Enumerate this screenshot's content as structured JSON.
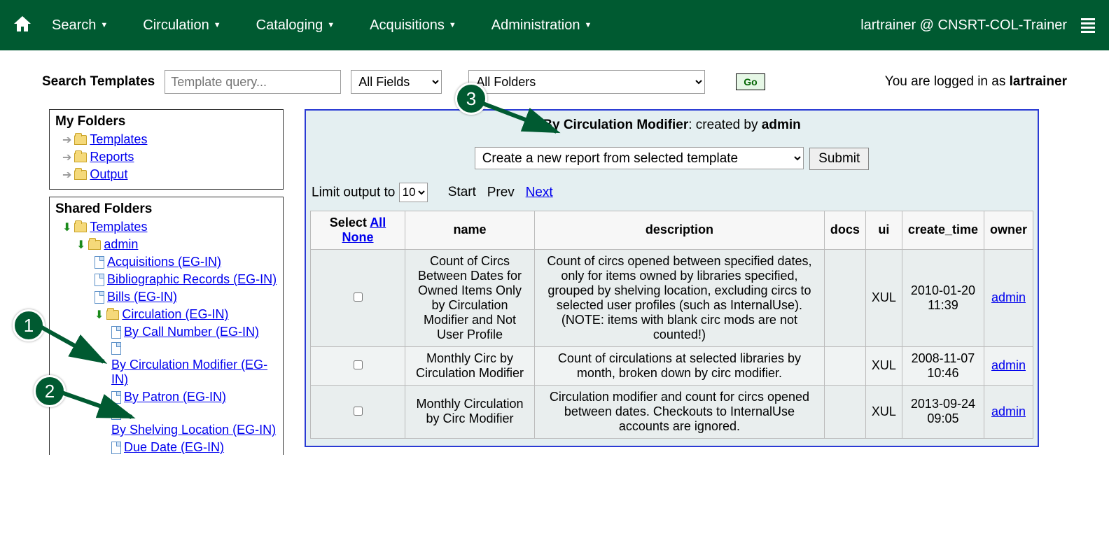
{
  "nav": {
    "items": [
      "Search",
      "Circulation",
      "Cataloging",
      "Acquisitions",
      "Administration"
    ],
    "user_text": "lartrainer @ CNSRT-COL-Trainer"
  },
  "search": {
    "label": "Search Templates",
    "placeholder": "Template query...",
    "fields_option": "All Fields",
    "folders_option": "All Folders",
    "go": "Go",
    "logged_in_prefix": "You are logged in as ",
    "logged_in_user": "lartrainer"
  },
  "sidebar": {
    "my_title": "My Folders",
    "my_items": [
      "Templates",
      "Reports",
      "Output"
    ],
    "shared_title": "Shared Folders",
    "shared": {
      "templates": "Templates",
      "admin": "admin",
      "items": [
        "Acquisitions (EG-IN)",
        "Bibliographic Records (EG-IN)",
        "Bills (EG-IN)"
      ],
      "circulation": "Circulation (EG-IN)",
      "circ_children": [
        "By Call Number (EG-IN)",
        "By Circulation Modifier (EG-IN)",
        "By Patron (EG-IN)",
        "By Shelving Location (EG-IN)",
        "Due Date (EG-IN)"
      ]
    }
  },
  "main": {
    "folder_name": "By Circulation Modifier",
    "created_by_sep": ": created by ",
    "creator": "admin",
    "action_option": "Create a new report from selected template",
    "submit": "Submit",
    "limit_label": "Limit output to ",
    "limit_value": "10",
    "start": "Start",
    "prev": "Prev",
    "next": "Next",
    "columns": {
      "select": "Select",
      "sel_all": "All",
      "sel_none": "None",
      "name": "name",
      "description": "description",
      "docs": "docs",
      "ui": "ui",
      "create_time": "create_time",
      "owner": "owner"
    },
    "rows": [
      {
        "name": "Count of Circs Between Dates for Owned Items Only by Circulation Modifier and Not User Profile",
        "description": "Count of circs opened between specified dates, only for items owned by libraries specified, grouped by shelving location, excluding circs to selected user profiles (such as InternalUse). (NOTE: items with blank circ mods are not counted!)",
        "ui": "XUL",
        "create_time": "2010-01-20 11:39",
        "owner": "admin"
      },
      {
        "name": "Monthly Circ by Circulation Modifier",
        "description": "Count of circulations at selected libraries by month, broken down by circ modifier.",
        "ui": "XUL",
        "create_time": "2008-11-07 10:46",
        "owner": "admin"
      },
      {
        "name": "Monthly Circulation by Circ Modifier",
        "description": "Circulation modifier and count for circs opened between dates. Checkouts to InternalUse accounts are ignored.",
        "ui": "XUL",
        "create_time": "2013-09-24 09:05",
        "owner": "admin"
      }
    ]
  },
  "annotations": {
    "n1": "1",
    "n2": "2",
    "n3": "3"
  }
}
